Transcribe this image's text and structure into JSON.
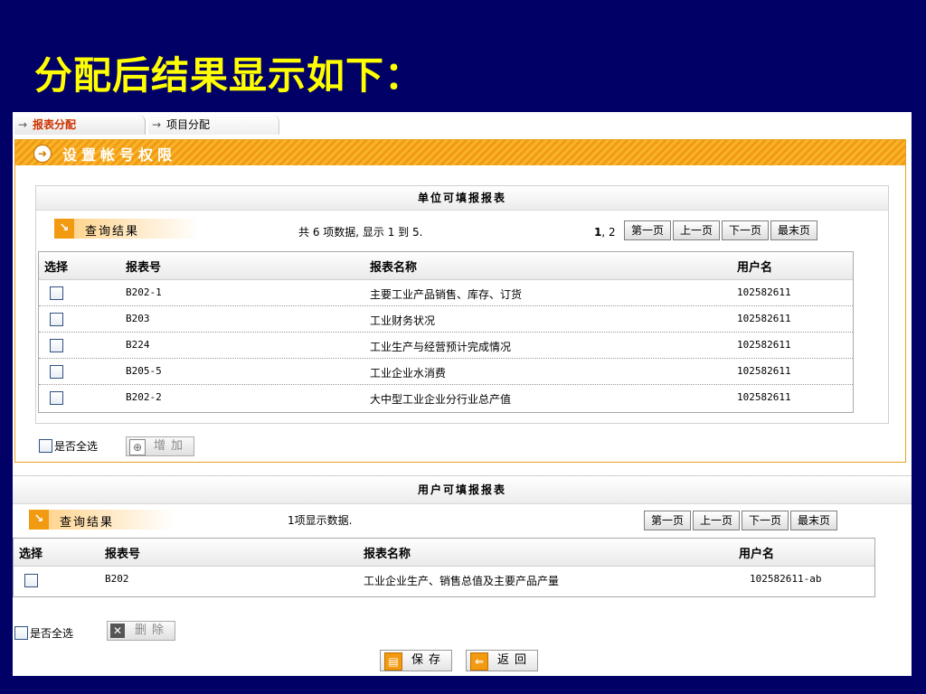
{
  "slide": {
    "title": "分配后结果显示如下："
  },
  "tabs": [
    {
      "label": "报表分配",
      "arrow": "→"
    },
    {
      "label": "项目分配",
      "arrow": "→"
    }
  ],
  "section1": {
    "title": "设置帐号权限",
    "panel_title": "单位可填报报表",
    "query_label": "查询结果",
    "count_text": "共 6 项数据, 显示 1 到 5.",
    "pages_current": "1",
    "pages_rest": ", 2",
    "pager": {
      "first": "第一页",
      "prev": "上一页",
      "next": "下一页",
      "last": "最末页"
    },
    "columns": {
      "select": "选择",
      "report_no": "报表号",
      "report_name": "报表名称",
      "user": "用户名"
    },
    "rows": [
      {
        "no": "B202-1",
        "name": "主要工业产品销售、库存、订货",
        "user": "102582611"
      },
      {
        "no": "B203",
        "name": "工业财务状况",
        "user": "102582611"
      },
      {
        "no": "B224",
        "name": "工业生产与经营预计完成情况",
        "user": "102582611"
      },
      {
        "no": "B205-5",
        "name": "工业企业水消费",
        "user": "102582611"
      },
      {
        "no": "B202-2",
        "name": "大中型工业企业分行业总产值",
        "user": "102582611"
      }
    ],
    "select_all": "是否全选",
    "add_button": "增加"
  },
  "section2": {
    "panel_title": "用户可填报报表",
    "query_label": "查询结果",
    "count_text": "1项显示数据.",
    "pager": {
      "first": "第一页",
      "prev": "上一页",
      "next": "下一页",
      "last": "最末页"
    },
    "columns": {
      "select": "选择",
      "report_no": "报表号",
      "report_name": "报表名称",
      "user": "用户名"
    },
    "rows": [
      {
        "no": "B202",
        "name": "工业企业生产、销售总值及主要产品产量",
        "user": "102582611-ab"
      }
    ],
    "select_all": "是否全选",
    "delete_button": "删除"
  },
  "footer": {
    "save_button": "保存",
    "back_button": "返回"
  },
  "colors": {
    "slide_bg": "#000066",
    "title": "#FFFF00",
    "accent_orange": "#F29A12",
    "active_tab": "#CC3300"
  }
}
